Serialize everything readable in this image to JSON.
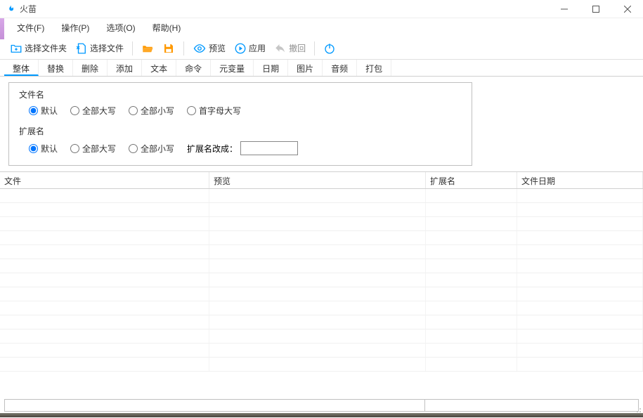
{
  "title": "火苗",
  "menu": {
    "file": "文件(F)",
    "op": "操作(P)",
    "options": "选项(O)",
    "help": "帮助(H)"
  },
  "toolbar": {
    "select_folder": "选择文件夹",
    "select_file": "选择文件",
    "preview": "预览",
    "apply": "应用",
    "undo": "撤回"
  },
  "tabs": [
    "整体",
    "替换",
    "删除",
    "添加",
    "文本",
    "命令",
    "元变量",
    "日期",
    "图片",
    "音频",
    "打包"
  ],
  "active_tab": 0,
  "group_filename": {
    "label": "文件名",
    "opts": {
      "default": "默认",
      "upper": "全部大写",
      "lower": "全部小写",
      "cap": "首字母大写"
    },
    "selected": "default"
  },
  "group_ext": {
    "label": "扩展名",
    "opts": {
      "default": "默认",
      "upper": "全部大写",
      "lower": "全部小写"
    },
    "selected": "default",
    "change_label": "扩展名改成：",
    "change_value": ""
  },
  "grid": {
    "headers": {
      "file": "文件",
      "preview": "预览",
      "ext": "扩展名",
      "date": "文件日期"
    }
  },
  "colors": {
    "accent": "#0099ff",
    "accent2": "#ff9900",
    "muted": "#999999"
  }
}
